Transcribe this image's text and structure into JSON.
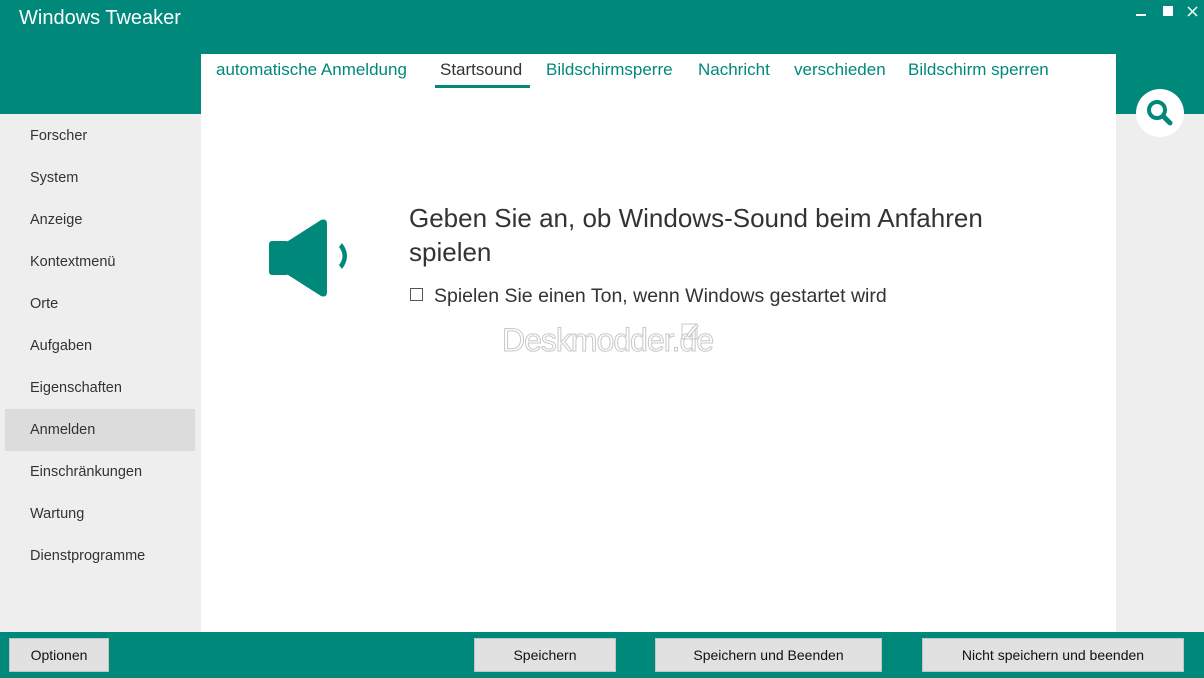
{
  "window": {
    "title": "Windows Tweaker",
    "controls": {
      "minimize": "",
      "maximize": "",
      "close": ""
    }
  },
  "sidebar": {
    "items": [
      {
        "label": "Forscher"
      },
      {
        "label": "System"
      },
      {
        "label": "Anzeige"
      },
      {
        "label": "Kontextmenü"
      },
      {
        "label": "Orte"
      },
      {
        "label": "Aufgaben"
      },
      {
        "label": "Eigenschaften"
      },
      {
        "label": "Anmelden",
        "active": true
      },
      {
        "label": "Einschränkungen"
      },
      {
        "label": "Wartung"
      },
      {
        "label": "Dienstprogramme"
      }
    ]
  },
  "tabs": [
    {
      "label": "automatische Anmeldung"
    },
    {
      "label": "Startsound",
      "active": true
    },
    {
      "label": "Bildschirmsperre"
    },
    {
      "label": "Nachricht"
    },
    {
      "label": "verschieden"
    },
    {
      "label": "Bildschirm sperren"
    }
  ],
  "main": {
    "heading": "Geben Sie an, ob Windows-Sound beim Anfahren spielen",
    "checkbox_label": "Spielen Sie einen Ton, wenn Windows gestartet wird",
    "checkbox_checked": false,
    "watermark": "Deskmodder.de"
  },
  "footer": {
    "options": "Optionen",
    "save": "Speichern",
    "save_exit": "Speichern und Beenden",
    "nosave_exit": "Nicht speichern und beenden"
  },
  "colors": {
    "accent": "#00897b",
    "sidebar_bg": "#eeeeee",
    "sidebar_active": "#dcdcdc",
    "button_bg": "#e1e1e1"
  },
  "icons": {
    "speaker": "speaker-icon",
    "search": "search-icon"
  }
}
